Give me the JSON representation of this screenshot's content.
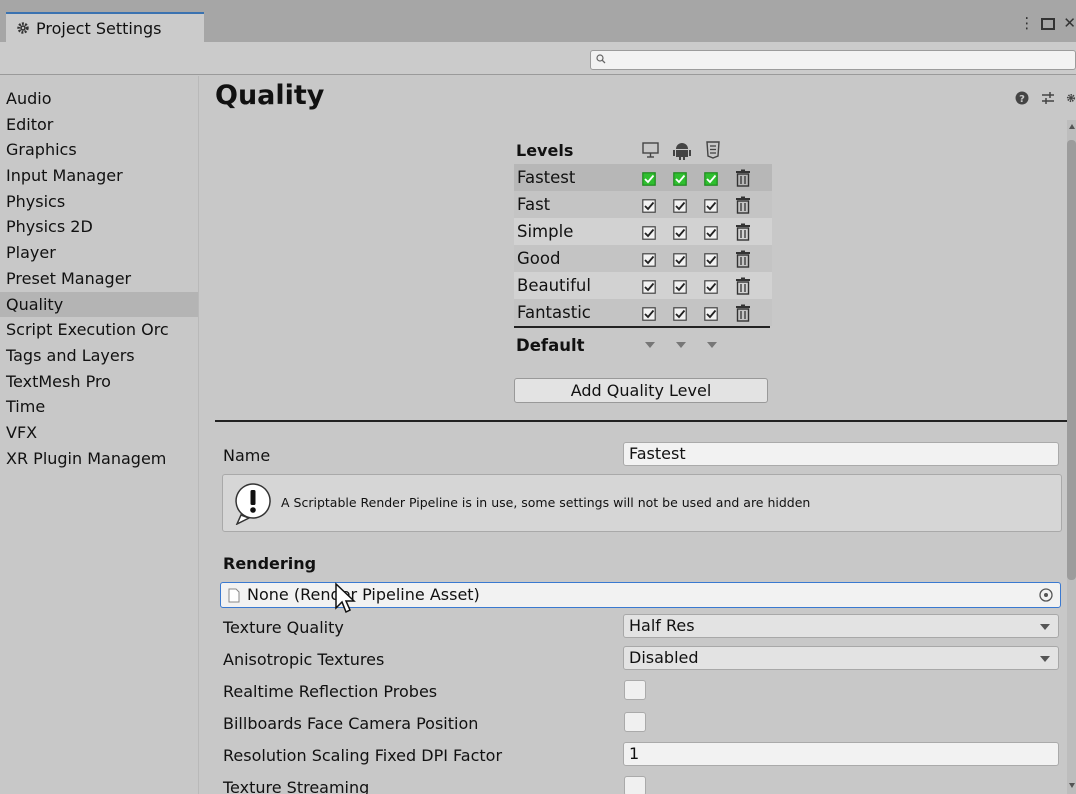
{
  "window": {
    "tab_title": "Project Settings",
    "search": {
      "placeholder": ""
    }
  },
  "sidebar": {
    "items": [
      {
        "label": "Audio",
        "selected": false
      },
      {
        "label": "Editor",
        "selected": false
      },
      {
        "label": "Graphics",
        "selected": false
      },
      {
        "label": "Input Manager",
        "selected": false
      },
      {
        "label": "Physics",
        "selected": false
      },
      {
        "label": "Physics 2D",
        "selected": false
      },
      {
        "label": "Player",
        "selected": false
      },
      {
        "label": "Preset Manager",
        "selected": false
      },
      {
        "label": "Quality",
        "selected": true
      },
      {
        "label": "Script Execution Orc",
        "selected": false
      },
      {
        "label": "Tags and Layers",
        "selected": false
      },
      {
        "label": "TextMesh Pro",
        "selected": false
      },
      {
        "label": "Time",
        "selected": false
      },
      {
        "label": "VFX",
        "selected": false
      },
      {
        "label": "XR Plugin Managem",
        "selected": false
      }
    ]
  },
  "main": {
    "title": "Quality",
    "levels": {
      "header": "Levels",
      "platforms": [
        "desktop-icon",
        "android-icon",
        "html5-icon"
      ],
      "rows": [
        {
          "name": "Fastest",
          "checks": [
            true,
            true,
            true
          ],
          "highlighted": true
        },
        {
          "name": "Fast",
          "checks": [
            true,
            true,
            true
          ],
          "highlighted": false
        },
        {
          "name": "Simple",
          "checks": [
            true,
            true,
            true
          ],
          "highlighted": false
        },
        {
          "name": "Good",
          "checks": [
            true,
            true,
            true
          ],
          "highlighted": false
        },
        {
          "name": "Beautiful",
          "checks": [
            true,
            true,
            true
          ],
          "highlighted": false
        },
        {
          "name": "Fantastic",
          "checks": [
            true,
            true,
            true
          ],
          "highlighted": false
        }
      ],
      "default_label": "Default",
      "add_button": "Add Quality Level"
    },
    "name_label": "Name",
    "name_value": "Fastest",
    "help_message": "A Scriptable Render Pipeline is in use, some settings will not be used and are hidden",
    "rendering": {
      "section_title": "Rendering",
      "pipeline_asset": "None (Render Pipeline Asset)",
      "texture_quality_label": "Texture Quality",
      "texture_quality_value": "Half Res",
      "anisotropic_label": "Anisotropic Textures",
      "anisotropic_value": "Disabled",
      "reflection_probes_label": "Realtime Reflection Probes",
      "billboards_label": "Billboards Face Camera Position",
      "dpi_label": "Resolution Scaling Fixed DPI Factor",
      "dpi_value": "1",
      "streaming_label": "Texture Streaming"
    }
  },
  "colors": {
    "selected_check": "#2fbf2f",
    "focus_border": "#3a79d0",
    "tab_accent": "#3a72b0"
  }
}
